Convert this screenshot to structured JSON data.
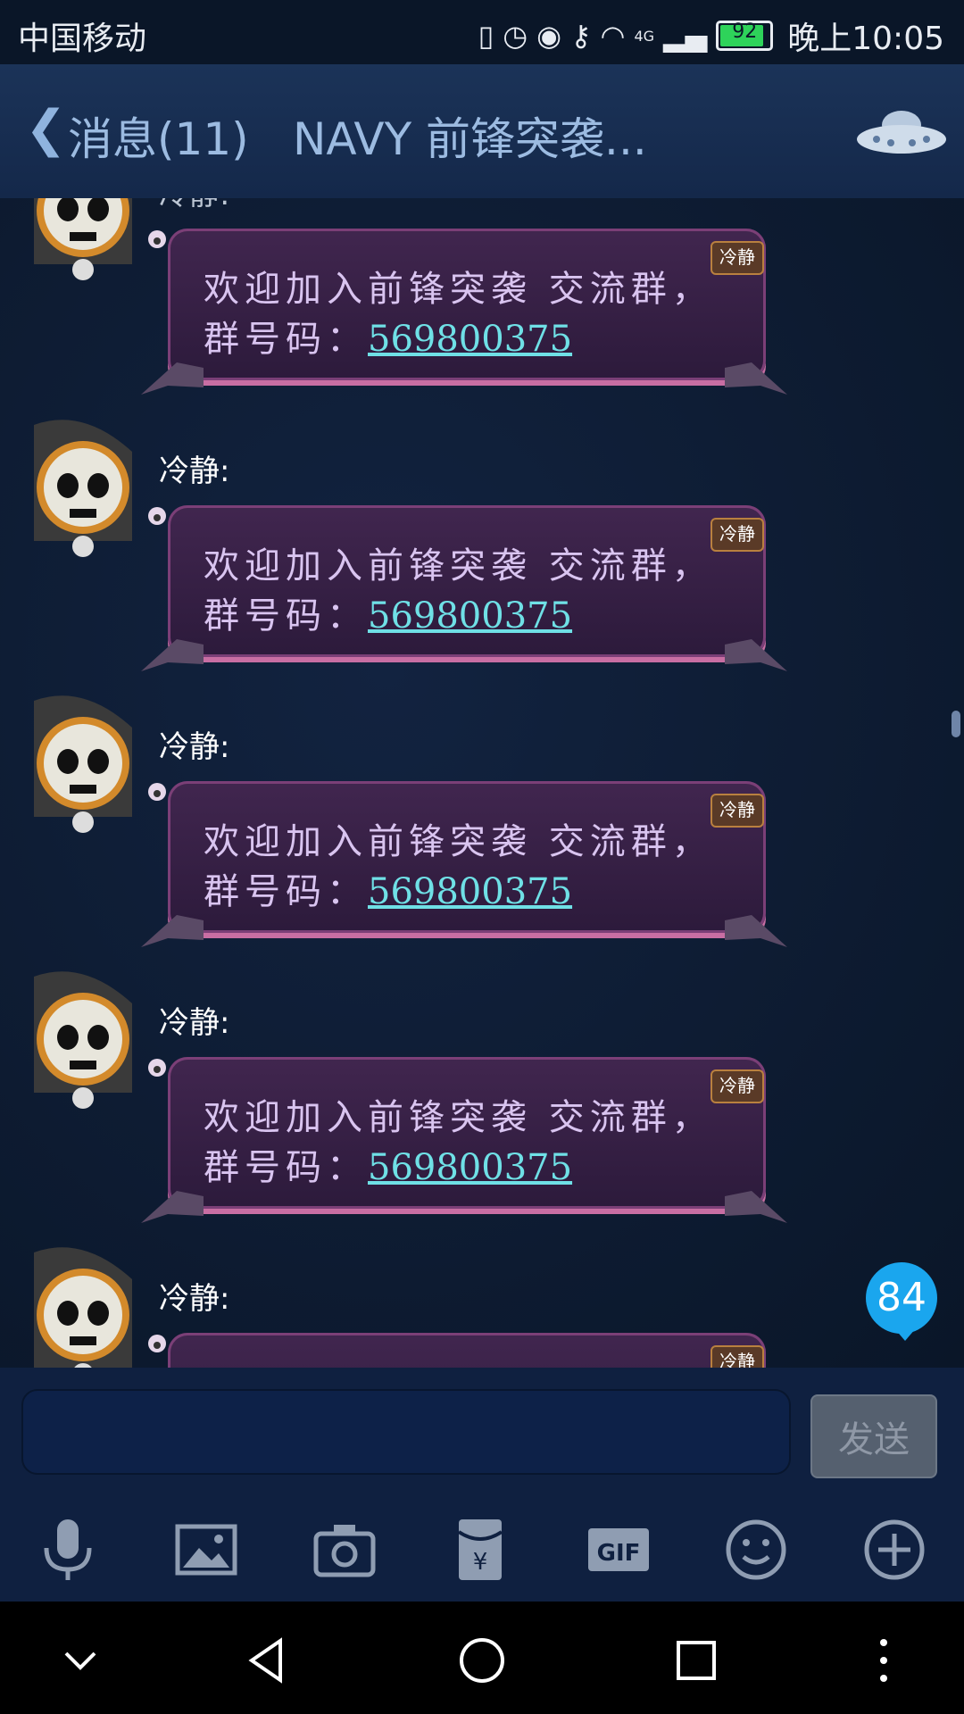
{
  "status_bar": {
    "carrier": "中国移动",
    "network": "4G",
    "battery": "92",
    "time": "晚上10:05"
  },
  "header": {
    "back_label": "消息(11)",
    "title": "NAVY 前锋突袭...",
    "menu_icon": "ufo-icon"
  },
  "messages": [
    {
      "sender": "冷静:",
      "text": "欢迎加入前锋突袭 交流群，群号码：",
      "number": "569800375",
      "tag": "冷静"
    },
    {
      "sender": "冷静:",
      "text": "欢迎加入前锋突袭 交流群，群号码：",
      "number": "569800375",
      "tag": "冷静"
    },
    {
      "sender": "冷静:",
      "text": "欢迎加入前锋突袭 交流群，群号码：",
      "number": "569800375",
      "tag": "冷静"
    },
    {
      "sender": "冷静:",
      "text": "欢迎加入前锋突袭 交流群，群号码：",
      "number": "569800375",
      "tag": "冷静"
    },
    {
      "sender": "冷静:",
      "text": "",
      "number": "",
      "tag": "冷静"
    }
  ],
  "unread_badge": "84",
  "input": {
    "value": "",
    "send_label": "发送"
  },
  "toolbar_icons": [
    "microphone-icon",
    "image-icon",
    "camera-icon",
    "red-packet-icon",
    "gif-icon",
    "emoji-icon",
    "plus-icon"
  ],
  "colors": {
    "background": "#0b1629",
    "bubble": "#3a2248",
    "link": "#6fe0e6",
    "badge": "#1aa6ee"
  }
}
